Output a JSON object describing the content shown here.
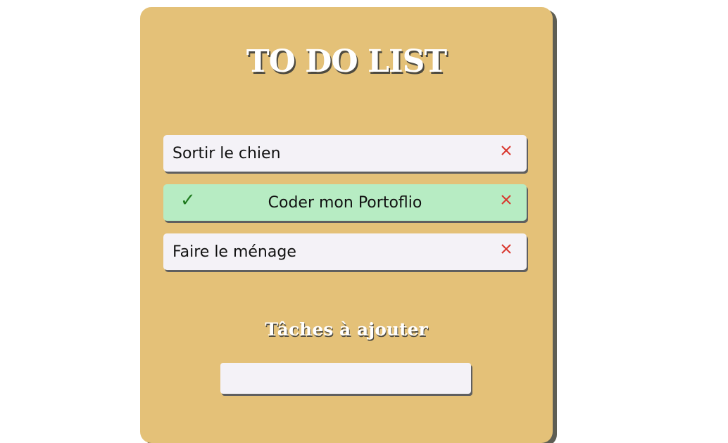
{
  "app": {
    "title": "TO DO LIST",
    "add_section_title": "Tâches à ajouter"
  },
  "tasks": [
    {
      "label": "Sortir le chien",
      "done": false
    },
    {
      "label": "Coder mon Portoflio",
      "done": true
    },
    {
      "label": "Faire le ménage",
      "done": false
    }
  ],
  "icons": {
    "done": "check-icon",
    "delete": "close-icon"
  },
  "input": {
    "value": "",
    "placeholder": ""
  },
  "colors": {
    "card_background": "#e4c178",
    "task_background": "#f4f2f7",
    "task_done_background": "#b7ecc3",
    "check_color": "#1f7a1f",
    "delete_color": "#d9372e"
  }
}
